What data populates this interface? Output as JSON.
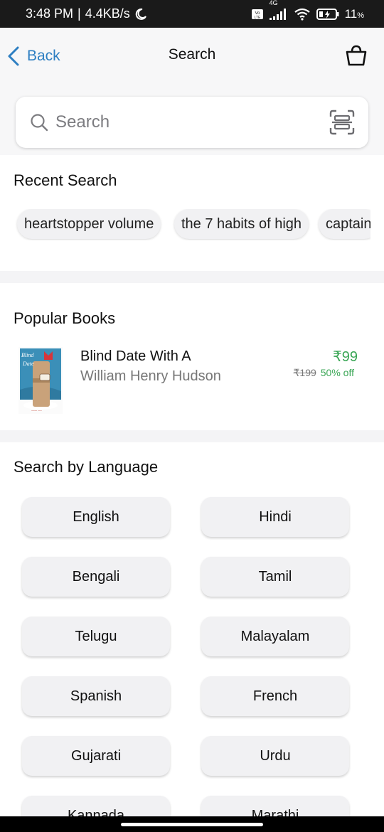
{
  "status_bar": {
    "time": "3:48 PM",
    "speed": "4.4KB/s",
    "network": "4G",
    "battery": "11",
    "battery_unit": "%"
  },
  "header": {
    "back_label": "Back",
    "title": "Search"
  },
  "search": {
    "placeholder": "Search",
    "value": ""
  },
  "recent_search": {
    "title": "Recent Search",
    "items": [
      "heartstopper volume",
      "the 7 habits of high",
      "captain"
    ]
  },
  "popular_books": {
    "title": "Popular Books",
    "books": [
      {
        "title": "Blind Date With A",
        "author": "William Henry Hudson",
        "price": "₹99",
        "mrp": "₹199",
        "discount": "50% off"
      }
    ]
  },
  "languages": {
    "title": "Search by Language",
    "items": [
      "English",
      "Hindi",
      "Bengali",
      "Tamil",
      "Telugu",
      "Malayalam",
      "Spanish",
      "French",
      "Gujarati",
      "Urdu",
      "Kannada",
      "Marathi"
    ]
  },
  "colors": {
    "accent_blue": "#2e7fc2",
    "price_green": "#3aa655",
    "status_bar_bg": "#1a1a1a"
  },
  "icons": {
    "back": "chevron-left-icon",
    "cart": "shopping-basket-icon",
    "search": "search-icon",
    "scan": "scan-icon",
    "moon": "moon-icon",
    "wifi": "wifi-icon",
    "signal": "signal-icon",
    "battery": "battery-icon"
  }
}
